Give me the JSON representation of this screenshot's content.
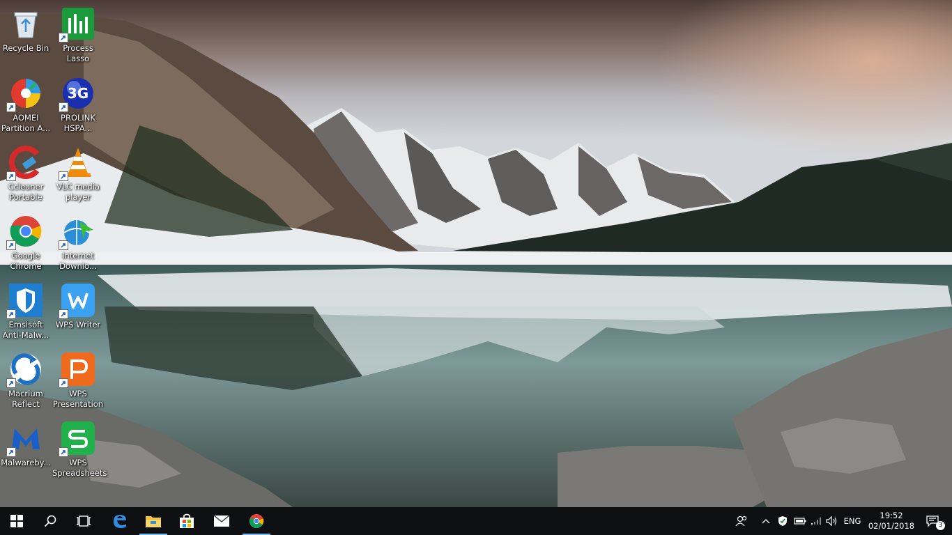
{
  "desktop": {
    "icons": [
      {
        "label": "Recycle Bin",
        "icon": "recycle-bin-icon"
      },
      {
        "label": "Process\nLasso",
        "icon": "process-lasso-icon"
      },
      {
        "label": "AOMEI\nPartition A...",
        "icon": "aomei-partition-icon"
      },
      {
        "label": "PROLINK\nHSPA...",
        "icon": "prolink-3g-icon"
      },
      {
        "label": "Ccleaner\nPortable",
        "icon": "ccleaner-icon"
      },
      {
        "label": "VLC media\nplayer",
        "icon": "vlc-icon"
      },
      {
        "label": "Google\nChrome",
        "icon": "chrome-icon"
      },
      {
        "label": "Internet\nDownlo...",
        "icon": "internet-download-manager-icon"
      },
      {
        "label": "Emsisoft\nAnti-Malw...",
        "icon": "emsisoft-icon"
      },
      {
        "label": "WPS Writer",
        "icon": "wps-writer-icon"
      },
      {
        "label": "Macrium\nReflect",
        "icon": "macrium-reflect-icon"
      },
      {
        "label": "WPS\nPresentation",
        "icon": "wps-presentation-icon"
      },
      {
        "label": "Malwareby...",
        "icon": "malwarebytes-icon"
      },
      {
        "label": "WPS\nSpreadsheets",
        "icon": "wps-spreadsheets-icon"
      }
    ]
  },
  "taskbar": {
    "pinned": [
      "start-icon",
      "search-icon",
      "task-view-icon",
      "edge-icon",
      "file-explorer-icon",
      "store-icon",
      "mail-icon",
      "chrome-icon"
    ],
    "tray": {
      "language": "ENG",
      "time": "19:52",
      "date": "02/01/2018",
      "notification_count": "3"
    }
  },
  "colors": {
    "taskbar": "#0d0f12",
    "active_indicator": "#76b9ed"
  }
}
